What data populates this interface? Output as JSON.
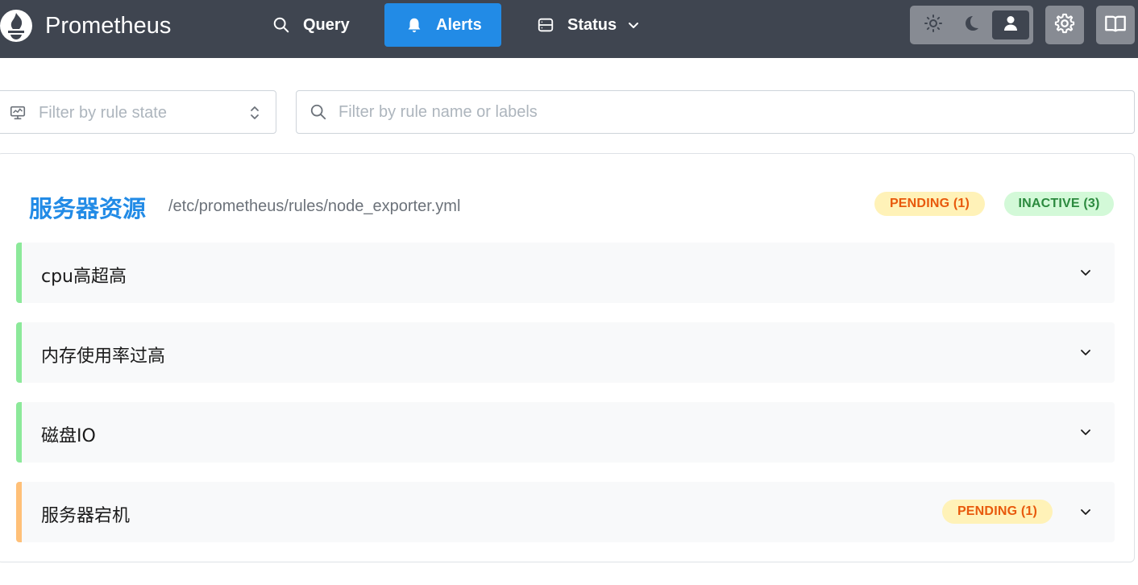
{
  "header": {
    "brand": "Prometheus",
    "nav": {
      "query": "Query",
      "alerts": "Alerts",
      "status": "Status"
    },
    "icons": {
      "logo": "prometheus-logo-icon",
      "query": "search-icon",
      "alerts": "bell-icon",
      "status": "server-icon",
      "theme_light": "sun-icon",
      "theme_dark": "moon-icon",
      "theme_auto": "user-icon",
      "settings": "gear-icon",
      "docs": "book-icon"
    },
    "active_tab": "alerts"
  },
  "filters": {
    "state_placeholder": "Filter by rule state",
    "search_placeholder": "Filter by rule name or labels",
    "search_value": ""
  },
  "group": {
    "name": "服务器资源",
    "file": "/etc/prometheus/rules/node_exporter.yml",
    "badges": {
      "pending": "PENDING (1)",
      "inactive": "INACTIVE (3)"
    },
    "rules": [
      {
        "name": "cpu高超高",
        "state": "inactive",
        "badge": ""
      },
      {
        "name": "内存使用率过高",
        "state": "inactive",
        "badge": ""
      },
      {
        "name": "磁盘IO",
        "state": "inactive",
        "badge": ""
      },
      {
        "name": "服务器宕机",
        "state": "pending",
        "badge": "PENDING (1)"
      }
    ]
  },
  "colors": {
    "header_bg": "#3f4550",
    "accent": "#228be6",
    "pending_bg": "#fff2b8",
    "pending_text": "#e8590c",
    "inactive_bg": "#d3f9d8",
    "inactive_text": "#2b8a3e",
    "inactive_bar": "#8ce99a",
    "pending_bar": "#ffc078"
  }
}
